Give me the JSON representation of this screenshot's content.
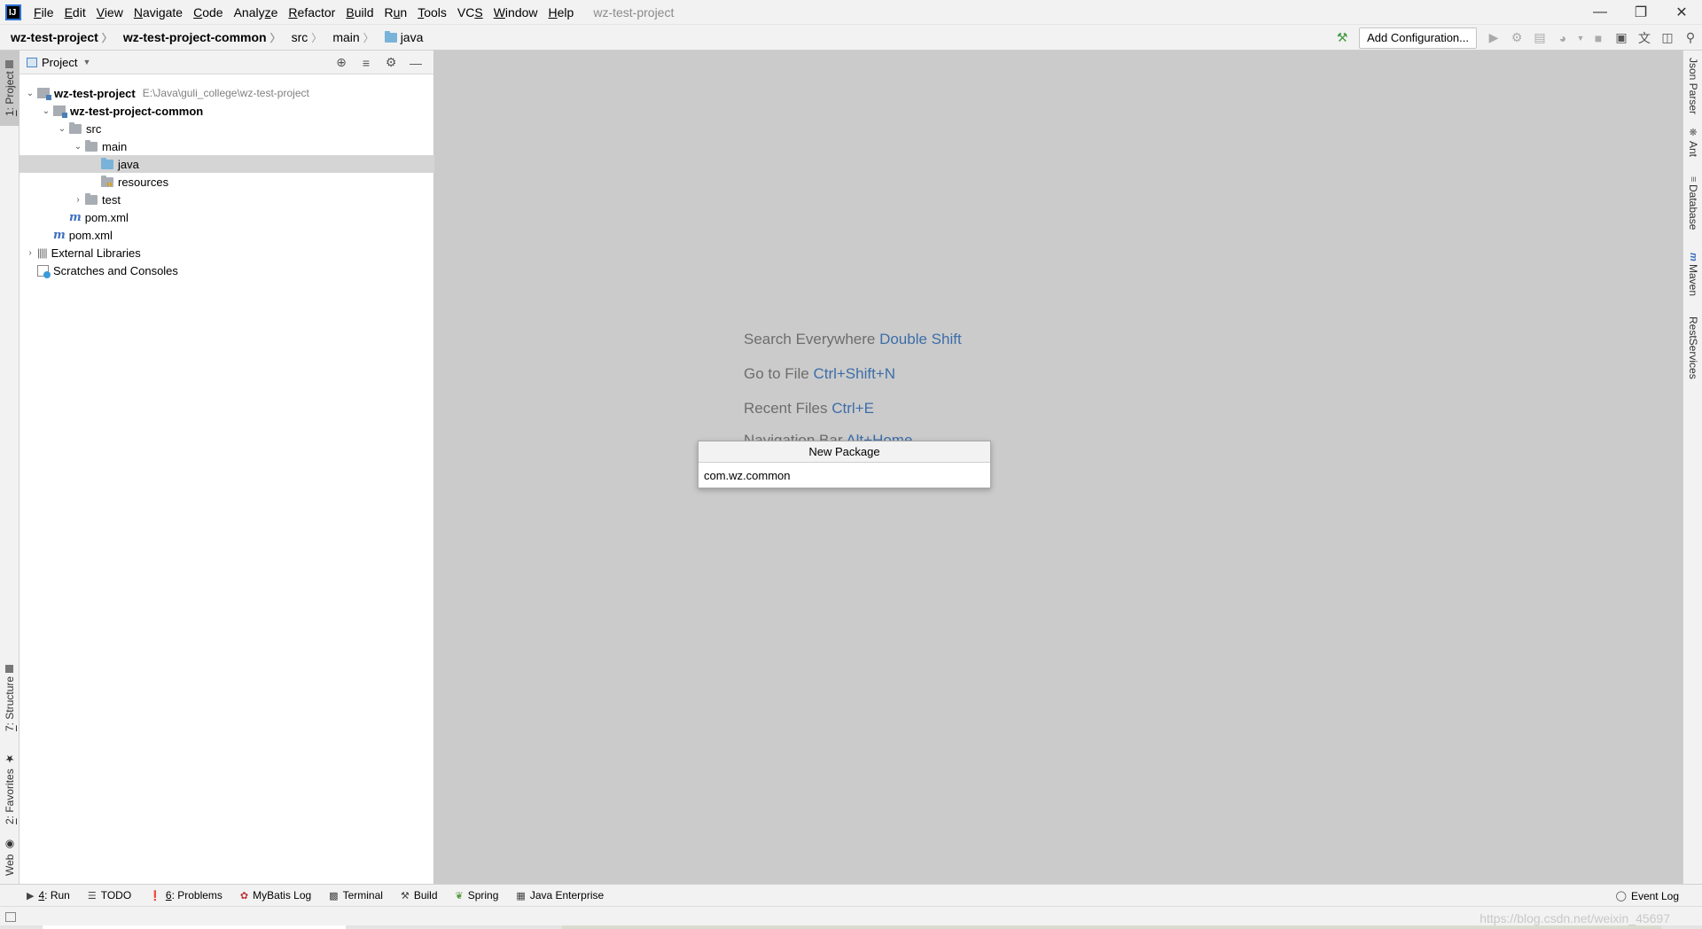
{
  "titlebar": {
    "menu": [
      {
        "pre": "",
        "u": "F",
        "post": "ile"
      },
      {
        "pre": "",
        "u": "E",
        "post": "dit"
      },
      {
        "pre": "",
        "u": "V",
        "post": "iew"
      },
      {
        "pre": "",
        "u": "N",
        "post": "avigate"
      },
      {
        "pre": "",
        "u": "C",
        "post": "ode"
      },
      {
        "pre": "Analy",
        "u": "z",
        "post": "e"
      },
      {
        "pre": "",
        "u": "R",
        "post": "efactor"
      },
      {
        "pre": "",
        "u": "B",
        "post": "uild"
      },
      {
        "pre": "R",
        "u": "u",
        "post": "n"
      },
      {
        "pre": "",
        "u": "T",
        "post": "ools"
      },
      {
        "pre": "VC",
        "u": "S",
        "post": ""
      },
      {
        "pre": "",
        "u": "W",
        "post": "indow"
      },
      {
        "pre": "",
        "u": "H",
        "post": "elp"
      }
    ],
    "window_title": "wz-test-project",
    "logo_text": "IJ"
  },
  "navbar": {
    "crumbs": [
      "wz-test-project",
      "wz-test-project-common",
      "src",
      "main",
      "java"
    ],
    "add_config_label": "Add Configuration..."
  },
  "left_stripe": {
    "project_tab": {
      "num": "1",
      "label": ": Project"
    },
    "structure_tab": {
      "num": "7",
      "label": ": Structure"
    },
    "favorites_tab": {
      "num": "2",
      "label": ": Favorites"
    },
    "web_tab": "Web"
  },
  "project_panel": {
    "title": "Project",
    "tree": [
      {
        "label": "wz-test-project",
        "hint": "E:\\Java\\guli_college\\wz-test-project"
      },
      {
        "label": "wz-test-project-common"
      },
      {
        "label": "src"
      },
      {
        "label": "main"
      },
      {
        "label": "java"
      },
      {
        "label": "resources"
      },
      {
        "label": "test"
      },
      {
        "label": "pom.xml"
      },
      {
        "label": "pom.xml"
      },
      {
        "label": "External Libraries"
      },
      {
        "label": "Scratches and Consoles"
      }
    ]
  },
  "editor": {
    "hints": [
      {
        "text": "Search Everywhere",
        "key": "Double Shift"
      },
      {
        "text": "Go to File",
        "key": "Ctrl+Shift+N"
      },
      {
        "text": "Recent Files",
        "key": "Ctrl+E"
      },
      {
        "text": "Navigation Bar",
        "key": "Alt+Home"
      }
    ]
  },
  "dialog": {
    "title": "New Package",
    "value": "com.wz.common"
  },
  "right_stripe": [
    "Json Parser",
    "Ant",
    "Database",
    "Maven",
    "RestServices"
  ],
  "bottom_tools": {
    "run": {
      "num": "4",
      "label": ": Run"
    },
    "todo": "TODO",
    "problems": {
      "num": "6",
      "label": ": Problems"
    },
    "mybatis": "MyBatis Log",
    "terminal": "Terminal",
    "build": "Build",
    "spring": "Spring",
    "java_ee": "Java Enterprise",
    "event_log": "Event Log"
  },
  "status": {
    "watermark": "https://blog.csdn.net/weixin_45697"
  }
}
